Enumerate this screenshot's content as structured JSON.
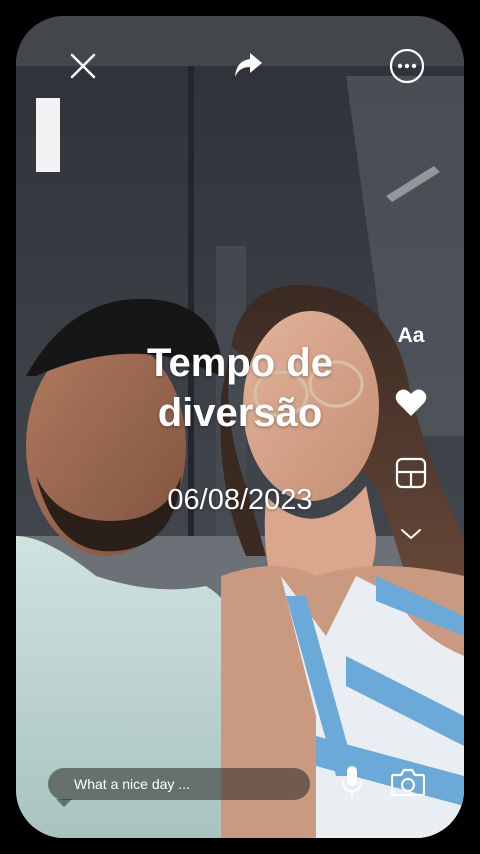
{
  "card": {
    "title": "Tempo de diversão",
    "date": "06/08/2023"
  },
  "toolbar": {
    "close_icon": "close-icon",
    "share_icon": "share-forward-icon",
    "more_icon": "more-options-icon"
  },
  "side_tools": {
    "text_label": "Aa",
    "like_icon": "heart-icon",
    "layout_icon": "layout-grid-icon",
    "expand_icon": "chevron-down-icon"
  },
  "caption": {
    "placeholder": "What a nice day ..."
  },
  "bottom_tools": {
    "mic_icon": "microphone-icon",
    "camera_icon": "camera-icon"
  },
  "colors": {
    "background": "#000000",
    "overlay_text": "#ffffff"
  }
}
